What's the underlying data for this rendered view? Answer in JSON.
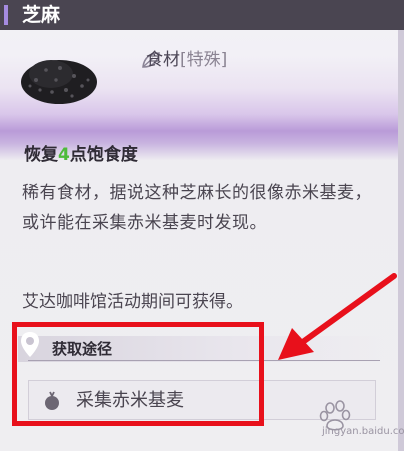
{
  "window": {
    "title": "芝麻"
  },
  "item": {
    "category": "食材",
    "category_tag": "[特殊]",
    "effect_prefix": "恢复",
    "effect_value": "4",
    "effect_suffix": "点饱食度",
    "description": "稀有食材，据说这种芝麻长的很像赤米基麦，或许能在采集赤米基麦时发现。",
    "event_note": "艾达咖啡馆活动期间可获得。"
  },
  "source": {
    "header": "获取途径",
    "button_label": "采集赤米基麦"
  },
  "annotation": {
    "highlight_color": "#e8101b",
    "arrow_color": "#e8101b"
  },
  "watermark": {
    "text": "jingyan.baidu.com"
  },
  "colors": {
    "accent": "#a58be0",
    "effect_value": "#4dbb3a"
  }
}
